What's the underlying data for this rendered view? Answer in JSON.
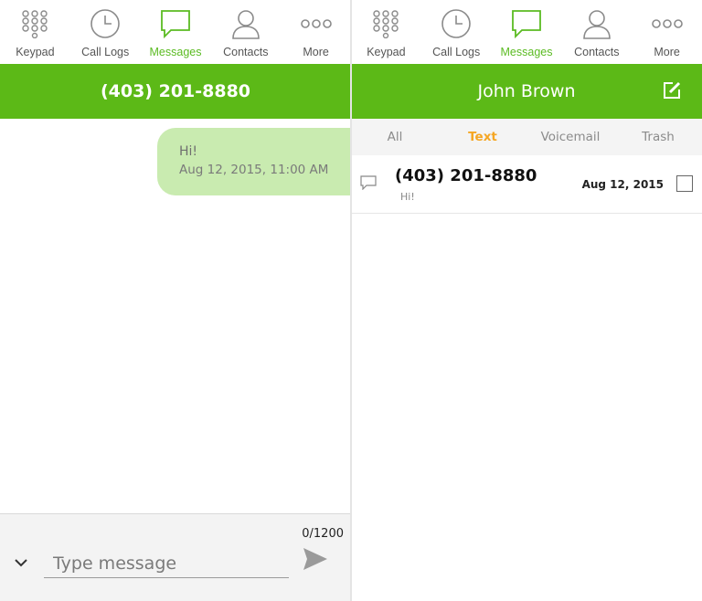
{
  "colors": {
    "accent": "#5cb917",
    "active_tab": "#5bbb22",
    "filter_active": "#f5a623",
    "bubble": "#c9ebb0"
  },
  "tabs": [
    {
      "label": "Keypad",
      "icon": "keypad-icon"
    },
    {
      "label": "Call Logs",
      "icon": "clock-icon"
    },
    {
      "label": "Messages",
      "icon": "message-bubble-icon",
      "active": true
    },
    {
      "label": "Contacts",
      "icon": "person-icon"
    },
    {
      "label": "More",
      "icon": "more-dots-icon"
    }
  ],
  "conversation": {
    "title": "(403) 201-8880",
    "messages": [
      {
        "text": "Hi!",
        "timestamp": "Aug 12, 2015, 11:00 AM"
      }
    ],
    "composer": {
      "counter": "0/1200",
      "placeholder": "Type message",
      "value": ""
    }
  },
  "inbox": {
    "title": "John Brown",
    "filters": [
      {
        "label": "All"
      },
      {
        "label": "Text",
        "active": true
      },
      {
        "label": "Voicemail"
      },
      {
        "label": "Trash"
      }
    ],
    "items": [
      {
        "number": "(403) 201-8880",
        "preview": "Hi!",
        "date": "Aug 12, 2015",
        "checked": false
      }
    ]
  }
}
